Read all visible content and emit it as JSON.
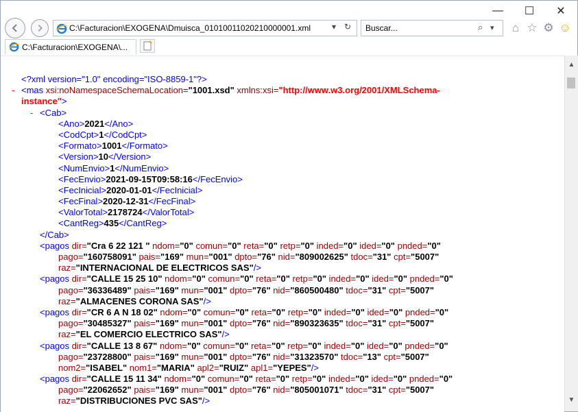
{
  "window": {
    "minimize": "—",
    "maximize": "☐",
    "close": "✕"
  },
  "nav": {
    "back_icon": "back-arrow-icon",
    "forward_icon": "forward-arrow-icon",
    "address_url": "C:\\Facturacion\\EXOGENA\\Dmuisca_01010011020210000001.xml",
    "search_placeholder": "Buscar..."
  },
  "tab": {
    "label": "C:\\Facturacion\\EXOGENA\\..."
  },
  "xml": {
    "decl": "<?xml version=\"1.0\" encoding=\"ISO-8859-1\"?>",
    "root_open_a": "<mas ",
    "root_attr1": "xsi:noNamespaceSchemaLocation=",
    "root_val1": "\"1001.xsd\"",
    "root_attr2": " xmlns:xsi=",
    "root_val2a": "\"http://www.w3.org/2001/XMLSchema-",
    "root_val2b": "instance\"",
    "root_close": ">",
    "cab_open": "<Cab>",
    "cab_close": "</Cab>",
    "cab_fields": [
      {
        "tag": "Ano",
        "value": "2021"
      },
      {
        "tag": "CodCpt",
        "value": "1"
      },
      {
        "tag": "Formato",
        "value": "1001"
      },
      {
        "tag": "Version",
        "value": "10"
      },
      {
        "tag": "NumEnvio",
        "value": "1"
      },
      {
        "tag": "FecEnvio",
        "value": "2021-09-15T09:58:16"
      },
      {
        "tag": "FecInicial",
        "value": "2020-01-01"
      },
      {
        "tag": "FecFinal",
        "value": "2020-12-31"
      },
      {
        "tag": "ValorTotal",
        "value": "2178724"
      },
      {
        "tag": "CantReg",
        "value": "435"
      }
    ],
    "pagos": [
      {
        "l1": [
          [
            "dir",
            "Cra 6 22 121 "
          ],
          [
            "ndom",
            "0"
          ],
          [
            "comun",
            "0"
          ],
          [
            "reta",
            "0"
          ],
          [
            "retp",
            "0"
          ],
          [
            "inded",
            "0"
          ],
          [
            "ided",
            "0"
          ],
          [
            "pnded",
            "0"
          ]
        ],
        "l2": [
          [
            "pago",
            "160758091"
          ],
          [
            "pais",
            "169"
          ],
          [
            "mun",
            "001"
          ],
          [
            "dpto",
            "76"
          ],
          [
            "nid",
            "809002625"
          ],
          [
            "tdoc",
            "31"
          ],
          [
            "cpt",
            "5007"
          ]
        ],
        "l3": [
          [
            "raz",
            "INTERNACIONAL DE ELECTRICOS SAS"
          ]
        ]
      },
      {
        "l1": [
          [
            "dir",
            "CALLE 15 25 10"
          ],
          [
            "ndom",
            "0"
          ],
          [
            "comun",
            "0"
          ],
          [
            "reta",
            "0"
          ],
          [
            "retp",
            "0"
          ],
          [
            "inded",
            "0"
          ],
          [
            "ided",
            "0"
          ],
          [
            "pnded",
            "0"
          ]
        ],
        "l2": [
          [
            "pago",
            "36336489"
          ],
          [
            "pais",
            "169"
          ],
          [
            "mun",
            "001"
          ],
          [
            "dpto",
            "76"
          ],
          [
            "nid",
            "860500480"
          ],
          [
            "tdoc",
            "31"
          ],
          [
            "cpt",
            "5007"
          ]
        ],
        "l3": [
          [
            "raz",
            "ALMACENES CORONA SAS"
          ]
        ]
      },
      {
        "l1": [
          [
            "dir",
            "CR 6 A N 18 02"
          ],
          [
            "ndom",
            "0"
          ],
          [
            "comun",
            "0"
          ],
          [
            "reta",
            "0"
          ],
          [
            "retp",
            "0"
          ],
          [
            "inded",
            "0"
          ],
          [
            "ided",
            "0"
          ],
          [
            "pnded",
            "0"
          ]
        ],
        "l2": [
          [
            "pago",
            "30485327"
          ],
          [
            "pais",
            "169"
          ],
          [
            "mun",
            "001"
          ],
          [
            "dpto",
            "76"
          ],
          [
            "nid",
            "890323635"
          ],
          [
            "tdoc",
            "31"
          ],
          [
            "cpt",
            "5007"
          ]
        ],
        "l3": [
          [
            "raz",
            "EL COMERCIO ELECTRICO SAS"
          ]
        ]
      },
      {
        "l1": [
          [
            "dir",
            "CALLE 13 8 67"
          ],
          [
            "ndom",
            "0"
          ],
          [
            "comun",
            "0"
          ],
          [
            "reta",
            "0"
          ],
          [
            "retp",
            "0"
          ],
          [
            "inded",
            "0"
          ],
          [
            "ided",
            "0"
          ],
          [
            "pnded",
            "0"
          ]
        ],
        "l2": [
          [
            "pago",
            "23728800"
          ],
          [
            "pais",
            "169"
          ],
          [
            "mun",
            "001"
          ],
          [
            "dpto",
            "76"
          ],
          [
            "nid",
            "31323570"
          ],
          [
            "tdoc",
            "13"
          ],
          [
            "cpt",
            "5007"
          ]
        ],
        "l3": [
          [
            "nom2",
            "ISABEL"
          ],
          [
            "nom1",
            "MARIA"
          ],
          [
            "apl2",
            "RUIZ"
          ],
          [
            "apl1",
            "YEPES"
          ]
        ]
      },
      {
        "l1": [
          [
            "dir",
            "CALLE 15 11 34"
          ],
          [
            "ndom",
            "0"
          ],
          [
            "comun",
            "0"
          ],
          [
            "reta",
            "0"
          ],
          [
            "retp",
            "0"
          ],
          [
            "inded",
            "0"
          ],
          [
            "ided",
            "0"
          ],
          [
            "pnded",
            "0"
          ]
        ],
        "l2": [
          [
            "pago",
            "22062652"
          ],
          [
            "pais",
            "169"
          ],
          [
            "mun",
            "001"
          ],
          [
            "dpto",
            "76"
          ],
          [
            "nid",
            "805001071"
          ],
          [
            "tdoc",
            "31"
          ],
          [
            "cpt",
            "5007"
          ]
        ],
        "l3": [
          [
            "raz",
            "DISTRIBUCIONES PVC SAS"
          ]
        ]
      }
    ]
  }
}
